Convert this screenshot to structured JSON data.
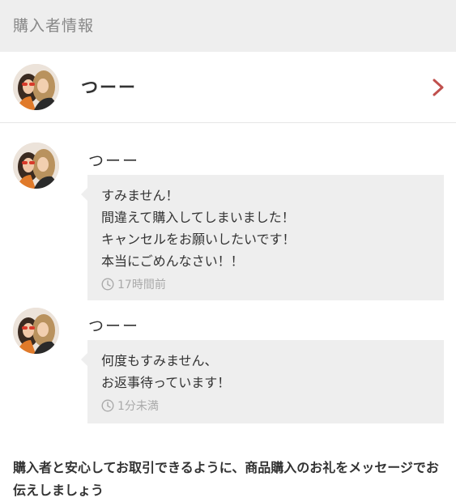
{
  "section": {
    "title": "購入者情報"
  },
  "buyer": {
    "name": "つーー",
    "avatar": "user-avatar-photo"
  },
  "messages": [
    {
      "author": "つーー",
      "lines": [
        "すみません！",
        "間違えて購入してしまいました！",
        "キャンセルをお願いしたいです！",
        "本当にごめんなさい！！"
      ],
      "time": "17時間前"
    },
    {
      "author": "つーー",
      "lines": [
        "何度もすみません、",
        "お返事待っています！"
      ],
      "time": "1分未満"
    }
  ],
  "notice": {
    "text": "購入者と安心してお取引できるように、商品購入のお礼をメッセージでお伝えしましょう"
  },
  "colors": {
    "header_bg": "#eeeeee",
    "bubble_bg": "#eeeeee",
    "chevron": "#c0504d",
    "muted_text": "#aaaaaa"
  },
  "icons": {
    "chevron": "chevron-right-icon",
    "clock": "clock-icon"
  }
}
